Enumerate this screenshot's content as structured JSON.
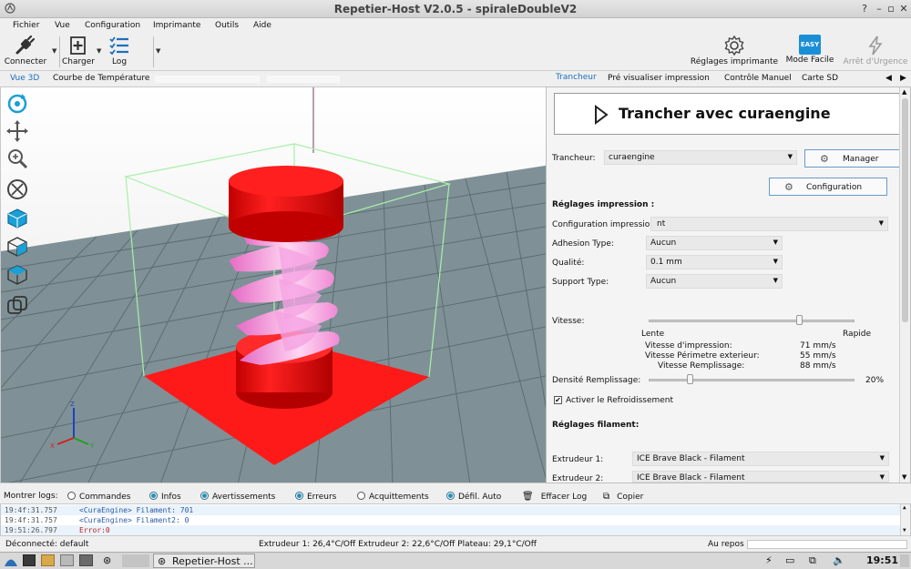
{
  "window": {
    "title": "Repetier-Host V2.0.5 - spiraleDoubleV2"
  },
  "menu": [
    "Fichier",
    "Vue",
    "Configuration",
    "Imprimante",
    "Outils",
    "Aide"
  ],
  "toolbar": {
    "connect": "Connecter",
    "load": "Charger",
    "log": "Log",
    "printer_settings": "Réglages imprimante",
    "easy_mode": "Mode Facile",
    "easy_badge": "EASY",
    "emergency": "Arrêt d'Urgence"
  },
  "left_tabs": [
    "Vue 3D",
    "Courbe de Température"
  ],
  "right_tabs": [
    "Trancheur",
    "Pré visualiser impression",
    "Contrôle Manuel",
    "Carte SD"
  ],
  "slicer": {
    "slice_button": "Trancher avec curaengine",
    "slicer_label": "Trancheur:",
    "slicer_value": "curaengine",
    "manager_button": "Manager",
    "config_button": "Configuration",
    "print_settings_header": "Réglages impression :",
    "print_config_label": "Configuration impression:",
    "print_config_value": "nt",
    "adhesion_label": "Adhesion Type:",
    "adhesion_value": "Aucun",
    "quality_label": "Qualité:",
    "quality_value": "0.1 mm",
    "support_label": "Support Type:",
    "support_value": "Aucun",
    "speed_label": "Vitesse:",
    "speed_position": 0.73,
    "speed_slow": "Lente",
    "speed_fast": "Rapide",
    "print_speed_label": "Vitesse d'impression:",
    "print_speed_value": "71 mm/s",
    "perimeter_speed_label": "Vitesse Périmetre exterieur:",
    "perimeter_speed_value": "55 mm/s",
    "infill_speed_label": "Vitesse Remplissage:",
    "infill_speed_value": "88 mm/s",
    "density_label": "Densité Remplissage:",
    "density_value": "20%",
    "density_position": 0.2,
    "cooling_label": "Activer le Refroidissement",
    "filament_header": "Réglages filament:",
    "extruder1_label": "Extrudeur 1:",
    "extruder1_value": "ICE Brave Black - Filament",
    "extruder2_label": "Extrudeur 2:",
    "extruder2_value": "ICE Brave Black - Filament"
  },
  "logbar": {
    "show_logs": "Montrer logs:",
    "commands": "Commandes",
    "infos": "Infos",
    "warnings": "Avertissements",
    "errors": "Erreurs",
    "acks": "Acquittements",
    "autoscroll": "Défil. Auto",
    "clear_log": "Effacer Log",
    "copy": "Copier"
  },
  "log": [
    {
      "time": "19:4f:31.757",
      "msg": "<CuraEngine> Filament: 701",
      "color": "#2a5aa8"
    },
    {
      "time": "19:4f:31.757",
      "msg": "<CuraEngine> Filament2: 0",
      "color": "#2a5aa8"
    },
    {
      "time": "19:51:26.797",
      "msg": "Error:0",
      "color": "#c02020"
    }
  ],
  "status": {
    "connection": "Déconnecté: default",
    "temps": "Extrudeur 1: 26,4°C/Off Extrudeur 2: 22,6°C/Off Plateau: 29,1°C/Off",
    "state": "Au repos"
  },
  "taskbar": {
    "app": "Repetier-Host ...",
    "clock": "19:51"
  },
  "colors": {
    "accent": "#1d6fbf",
    "model_red": "#ff1a1a",
    "spiral_pink": "#f58ad8",
    "grid_floor": "#7f9196"
  }
}
